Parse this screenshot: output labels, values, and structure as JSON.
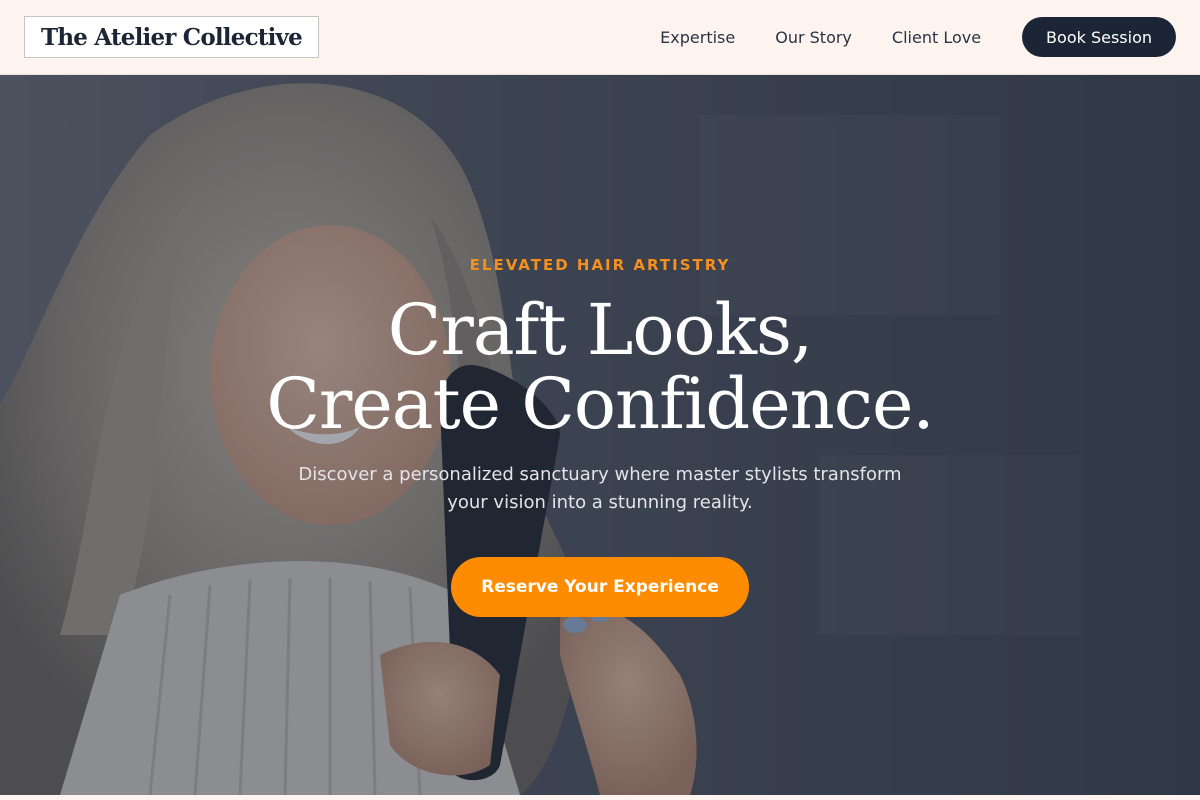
{
  "header": {
    "logo_text": "The Atelier Collective",
    "nav": [
      {
        "label": "Expertise"
      },
      {
        "label": "Our Story"
      },
      {
        "label": "Client Love"
      }
    ],
    "book_label": "Book Session"
  },
  "hero": {
    "eyebrow": "ELEVATED HAIR ARTISTRY",
    "headline_line1": "Craft Looks,",
    "headline_line2": "Create Confidence.",
    "subtext": "Discover a personalized sanctuary where master stylists transform your vision into a stunning reality.",
    "cta_label": "Reserve Your Experience",
    "image_description_icon": "hero-photo-woman-hair"
  },
  "colors": {
    "accent": "#ff8c00",
    "navy": "#1b2536",
    "header_bg": "#fdf4f0"
  }
}
